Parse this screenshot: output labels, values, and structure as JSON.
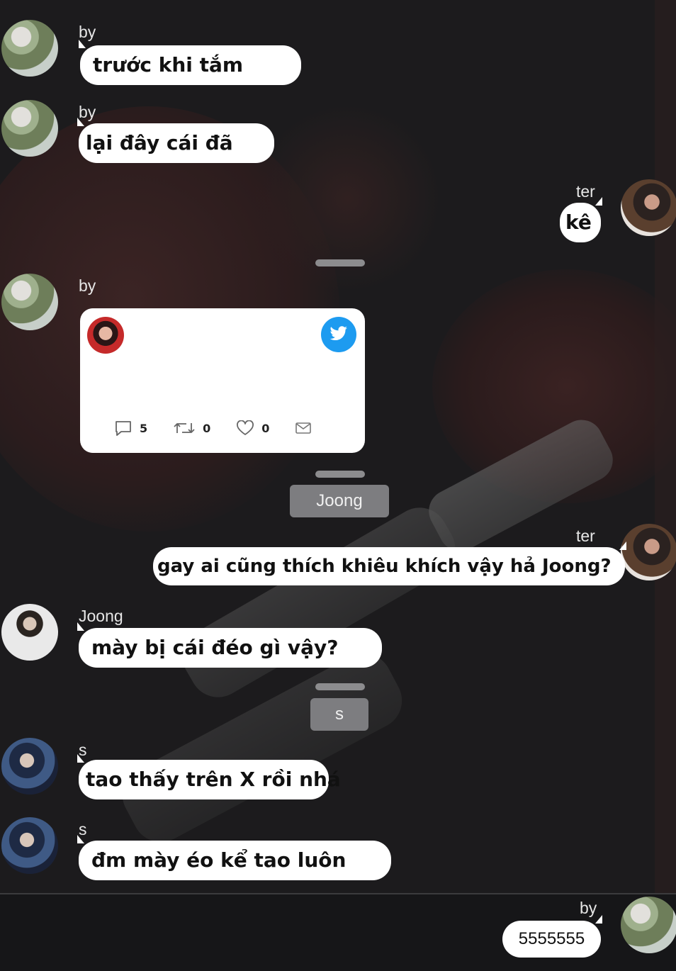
{
  "messages": [
    {
      "sender": "by",
      "text": "trước khi tắm"
    },
    {
      "sender": "by",
      "text": "lại đây cái đã"
    },
    {
      "sender": "ter",
      "text": "kê"
    },
    {
      "sender": "by",
      "tweet": {
        "replies": "5",
        "retweets": "0",
        "likes": "0"
      }
    },
    {
      "separator_label": "Joong"
    },
    {
      "sender": "ter",
      "text": "gay ai cũng thích khiêu khích vậy hả Joong?"
    },
    {
      "sender": "Joong",
      "text": "mày bị cái đéo gì vậy?"
    },
    {
      "separator_label": "s"
    },
    {
      "sender": "s",
      "text": "tao thấy trên X rồi nhá"
    },
    {
      "sender": "s",
      "text": "đm mày éo kể tao luôn"
    },
    {
      "sender": "by",
      "text": "5555555"
    }
  ],
  "icons": [
    "reply-icon",
    "retweet-icon",
    "like-icon",
    "mail-icon",
    "twitter-bird-icon"
  ],
  "colors": {
    "bubble": "#ffffff",
    "twitter_blue": "#1d9bf0",
    "separator_chip": "#7d7d80"
  }
}
